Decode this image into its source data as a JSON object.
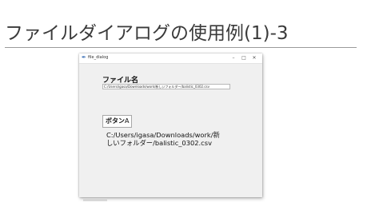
{
  "slide": {
    "title": "ファイルダイアログの使用例(1)-3"
  },
  "window": {
    "title": "file_dialog",
    "controls": {
      "minimize": "–",
      "maximize": "□",
      "close": "✕"
    }
  },
  "form": {
    "file_label": "ファイル名",
    "path_entry_value": "C:/Users/igasa/Downloads/work/新しいフォルダー/balistic_0302.csv",
    "button_a_bold": "ボタン",
    "button_a_rest": "A",
    "selected_path_line1": "C:/Users/igasa/Downloads/work/新",
    "selected_path_line2": "しいフォルダー/balistic_0302.csv"
  }
}
